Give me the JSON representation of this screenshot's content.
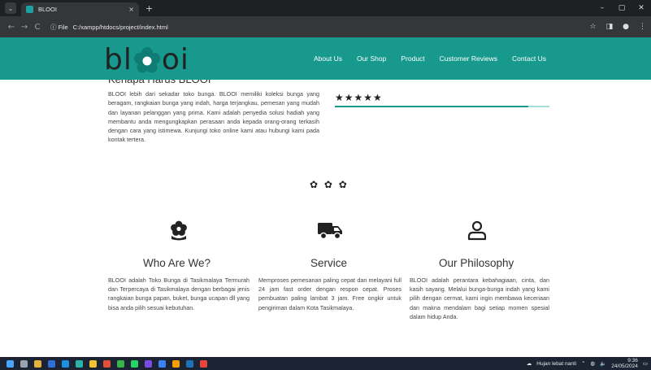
{
  "browser": {
    "tab_title": "BLOOI",
    "tab_close": "×",
    "new_tab": "+",
    "file_chip": "ⓘ File",
    "url": "C:/xampp/htdocs/project/index.html",
    "back": "←",
    "forward": "→",
    "reload": "C",
    "bookmark_icon": "☆",
    "window_controls": [
      "–",
      "▢",
      "✕"
    ]
  },
  "site": {
    "logo_left": "bl",
    "logo_right": "oi",
    "logo_color": "#17998d",
    "nav": [
      "About Us",
      "Our Shop",
      "Product",
      "Customer Reviews",
      "Contact Us"
    ],
    "peek_heading": "Kenapa Harus BLOOI",
    "about_text": "BLOOI lebih dari sekadar toko bunga. BLOOI memiliki koleksi bunga yang beragam, rangkaian bunga yang indah, harga terjangkau, pemesan yang mudah dan layanan pelanggan yang prima. Kami adalah penyedia solusi hadiah yang membantu anda mengungkapkan perasaan anda kepada orang-orang terkasih dengan cara yang istimewa. Kunjungi toko online kami atau hubungi kami pada kontak tertera.",
    "rating_stars": "★★★★★",
    "rating_fill_percent": 90,
    "gears": "✿ ✿ ✿",
    "features": [
      {
        "icon": "flower-icon",
        "title": "Who Are We?",
        "text": "BLOOI adalah Toko Bunga di Tasikmalaya Termurah dan Terpercaya di Tasikmalaya dengan berbagai jenis rangkaian bunga papan, buket, bunga ucapan dll yang bisa anda pilih sesuai kebutuhan."
      },
      {
        "icon": "truck-icon",
        "title": "Service",
        "text": "Memproses pemesanan paling cepat dan melayani full 24 jam fast order dengan respon cepat. Proses pembuatan paling lambat 3 jam. Free ongkir untuk pengiriman dalam Kota Tasikmalaya."
      },
      {
        "icon": "user-icon",
        "title": "Our Philosophy",
        "text": "BLOOI adalah perantara kebahagiaan, cinta, dan kasih sayang. Melalui bunga-bunga indah yang kami pilih dengan cermat, kami ingin membawa keceriaan dan makna mendalam bagi setiap momen spesial dalam hidup Anda."
      }
    ]
  },
  "taskbar": {
    "weather": "Hujan lebat nanti",
    "time": "9:36",
    "date": "24/05/2024"
  }
}
